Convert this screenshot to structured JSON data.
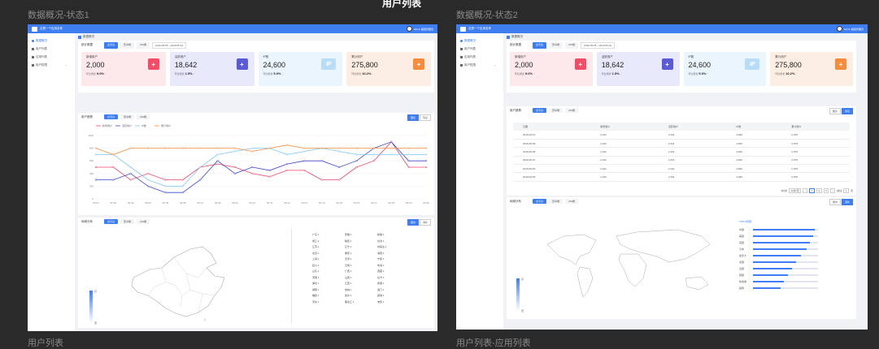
{
  "canvas": {
    "board_title": "用户列表",
    "labels": [
      "数据概况-状态1",
      "数据概况-状态2",
      "用户列表",
      "用户列表-应用列表"
    ]
  },
  "app": {
    "title": "这是一个应用名称",
    "user": "admin 超级管理员",
    "sidebar": [
      "数据概况",
      "用户列表",
      "应用列表",
      "用户权限"
    ],
    "breadcrumb": "数据概况"
  },
  "stats": {
    "title": "统计数据",
    "tabs": [
      "全平台",
      "安卓端",
      "iOS端"
    ],
    "date_range": "2019-05-05 ~ 2019-05-10",
    "cards": [
      {
        "label": "新增用户",
        "value": "2,000",
        "foot_label": "环比增长",
        "foot_value": "9.0%",
        "arrow": "↑",
        "dir": "up",
        "color": "#f34c68",
        "bg": "#fde8ec",
        "icon": "user-add-icon",
        "glyph": "+"
      },
      {
        "label": "活跃用户",
        "value": "18,642",
        "foot_label": "环比增长",
        "foot_value": "1.5%",
        "arrow": "↓",
        "dir": "down",
        "color": "#5a5ad6",
        "bg": "#e8e9fb",
        "icon": "user-active-icon",
        "glyph": "+"
      },
      {
        "label": "IP数",
        "value": "24,600",
        "foot_label": "环比增长",
        "foot_value": "5.0%",
        "arrow": "↑",
        "dir": "up",
        "color": "#b9dcf7",
        "bg": "#eaf5fd",
        "icon": "ip-icon",
        "glyph": "IP"
      },
      {
        "label": "累计用户",
        "value": "275,800",
        "foot_label": "环比增长",
        "foot_value": "10.2%",
        "arrow": "↑",
        "dir": "up",
        "color": "#f58b3c",
        "bg": "#fdeee3",
        "icon": "user-total-icon",
        "glyph": "+"
      }
    ]
  },
  "trend": {
    "title": "用户趋势",
    "tabs": [
      "全平台",
      "安卓端",
      "iOS端"
    ],
    "toggles": [
      "图表",
      "列表"
    ],
    "legend": [
      "新增用户",
      "活跃用户",
      "IP数",
      "累计用户"
    ]
  },
  "chart_data": {
    "type": "line",
    "x": [
      "05-01",
      "05-02",
      "05-03",
      "05-04",
      "05-05",
      "05-06",
      "05-07",
      "05-08",
      "05-09",
      "05-10",
      "05-11",
      "05-12",
      "05-13",
      "05-14",
      "05-15",
      "05-16",
      "05-17",
      "05-18",
      "05-19",
      "05-20"
    ],
    "ylim": [
      0,
      1000
    ],
    "yticks": [
      0,
      200,
      400,
      600,
      800,
      1000
    ],
    "series": [
      {
        "name": "新增用户",
        "color": "#e8476b",
        "values": [
          500,
          500,
          300,
          400,
          300,
          300,
          500,
          550,
          500,
          400,
          350,
          450,
          450,
          300,
          300,
          500,
          600,
          900,
          500,
          500
        ]
      },
      {
        "name": "活跃用户",
        "color": "#3d46c6",
        "values": [
          300,
          300,
          400,
          200,
          100,
          100,
          300,
          600,
          400,
          500,
          450,
          550,
          600,
          600,
          500,
          600,
          800,
          900,
          600,
          600
        ]
      },
      {
        "name": "IP数",
        "color": "#7fc6f2",
        "values": [
          700,
          700,
          500,
          300,
          200,
          200,
          500,
          700,
          750,
          800,
          800,
          700,
          750,
          800,
          750,
          700,
          700,
          700,
          700,
          700
        ]
      },
      {
        "name": "累计用户",
        "color": "#f08a3c",
        "values": [
          800,
          700,
          800,
          800,
          800,
          800,
          800,
          800,
          800,
          750,
          800,
          850,
          800,
          800,
          800,
          800,
          800,
          800,
          800,
          800
        ]
      }
    ]
  },
  "distribution": {
    "title": "地域分布",
    "tabs": [
      "全平台",
      "安卓端",
      "iOS端"
    ],
    "toggles_left": [
      "国内",
      "海外"
    ],
    "toggles_right": [
      "国内",
      "海外"
    ],
    "legend_high": "高",
    "legend_low": "低",
    "regions": [
      "广东 1",
      "浙江 1",
      "江苏 1",
      "北京 1",
      "上海 1",
      "四川 1",
      "山东 1",
      "河南 1",
      "湖北 1",
      "湖南 1",
      "福建 1",
      "河北 1",
      "安徽 1",
      "陕西 1",
      "辽宁 1",
      "重庆 1",
      "天津 1",
      "云南 1",
      "广西 1",
      "山西 1",
      "江西 1",
      "吉林 1",
      "贵州 1",
      "黑龙江 1",
      "新疆 1",
      "甘肃 1",
      "内蒙古 1",
      "海南 1",
      "宁夏 1",
      "青海 1",
      "西藏 1",
      "台湾 1",
      "香港 1",
      "澳门 1",
      "其他 1",
      "未知 1"
    ],
    "country_title": "TOP10国家",
    "countries": [
      {
        "name": "中国",
        "value": 0.95
      },
      {
        "name": "美国",
        "value": 0.92
      },
      {
        "name": "英国",
        "value": 0.87
      },
      {
        "name": "日本",
        "value": 0.82
      },
      {
        "name": "加拿大",
        "value": 0.74
      },
      {
        "name": "德国",
        "value": 0.66
      },
      {
        "name": "法国",
        "value": 0.6
      },
      {
        "name": "韩国",
        "value": 0.54
      },
      {
        "name": "新加坡",
        "value": 0.48
      },
      {
        "name": "其他",
        "value": 0.42
      }
    ]
  },
  "table": {
    "headers": [
      "日期",
      "新增用户",
      "活跃用户",
      "IP数",
      "累计用户"
    ],
    "rows": [
      [
        "2019-05-10",
        "2,342",
        "2,342",
        "4,894",
        "2,978"
      ],
      [
        "2019-05-09",
        "2,342",
        "2,342",
        "4,894",
        "2,978"
      ],
      [
        "2019-05-08",
        "2,342",
        "2,342",
        "4,894",
        "2,978"
      ],
      [
        "2019-05-07",
        "2,342",
        "2,342",
        "4,894",
        "2,978"
      ],
      [
        "2019-05-06",
        "2,342",
        "2,342",
        "4,894",
        "2,978"
      ],
      [
        "2019-05-05",
        "2,342",
        "2,342",
        "4,894",
        "2,978"
      ]
    ],
    "pager": {
      "total": "共6条",
      "size": "10条/页",
      "pages": [
        "1",
        "2",
        "3"
      ],
      "goto": "前往",
      "page": "1",
      "unit": "页"
    }
  }
}
